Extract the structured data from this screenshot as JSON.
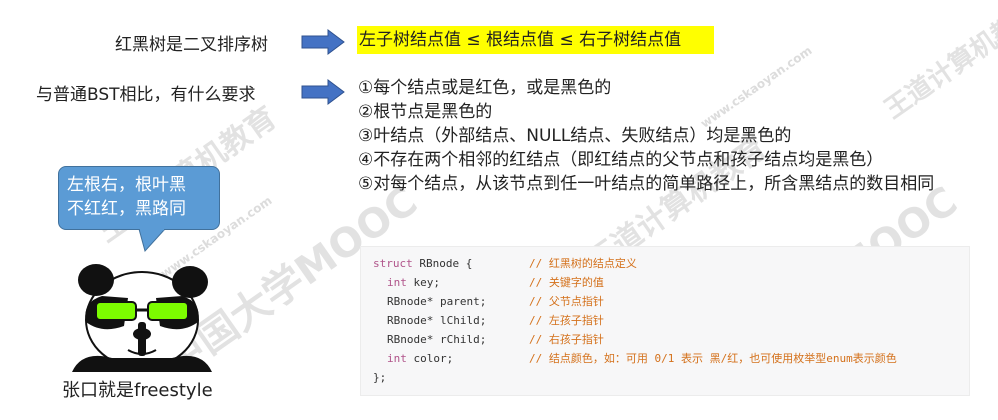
{
  "watermark": {
    "text_a": "中国大学MOOC",
    "text_b": "王道计算机教育",
    "text_c": "www.cskaoyan.com"
  },
  "row1": {
    "label": "红黑树是二叉排序树",
    "highlight": "左子树结点值 ≤ 根结点值 ≤ 右子树结点值"
  },
  "row2": {
    "label": "与普通BST相比，有什么要求"
  },
  "requirements": [
    "①每个结点或是红色，或是黑色的",
    "②根节点是黑色的",
    "③叶结点（外部结点、NULL结点、失败结点）均是黑色的",
    "④不存在两个相邻的红结点（即红结点的父节点和孩子结点均是黑色）",
    "⑤对每个结点，从该节点到任一叶结点的简单路径上，所含黑结点的数目相同"
  ],
  "bubble": {
    "line1": "左根右，根叶黑",
    "line2": "不红红，黑路同"
  },
  "panda_caption": "张口就是freestyle",
  "code": {
    "lines": [
      {
        "kw": "struct",
        "rest": " RBnode {",
        "comment": "// 红黑树的结点定义"
      },
      {
        "kw": "int",
        "rest": " key;",
        "comment": "// 关键字的值"
      },
      {
        "kw": "",
        "rest": "RBnode* parent;",
        "comment": "// 父节点指针"
      },
      {
        "kw": "",
        "rest": "RBnode* lChild;",
        "comment": "// 左孩子指针"
      },
      {
        "kw": "",
        "rest": "RBnode* rChild;",
        "comment": "// 右孩子指针"
      },
      {
        "kw": "int",
        "rest": " color;",
        "comment": "// 结点颜色，如：可用 0/1 表示 黑/红，也可使用枚举型enum表示颜色"
      },
      {
        "kw": "",
        "rest": "};",
        "comment": ""
      }
    ]
  },
  "colors": {
    "arrow": "#4472c4",
    "highlight": "#ffff00",
    "bubble": "#5b9bd5",
    "comment": "#d4711b",
    "keyword": "#b0548a"
  }
}
